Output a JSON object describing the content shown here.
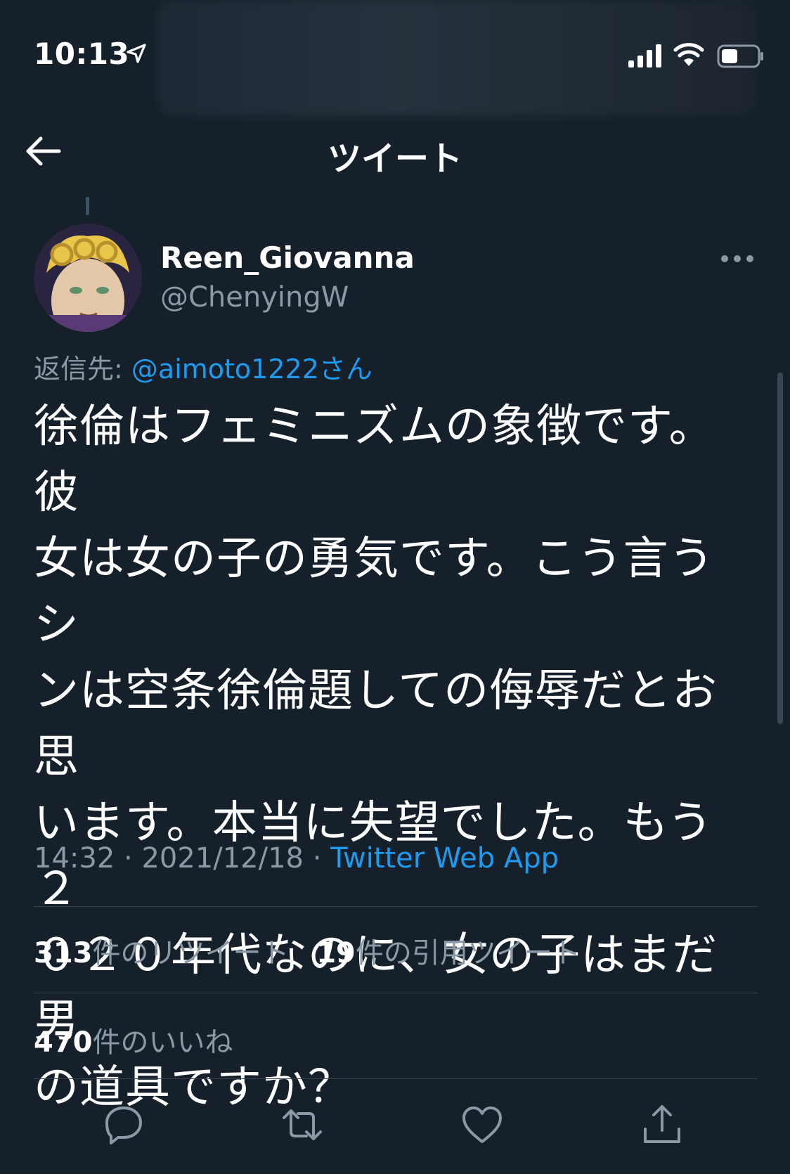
{
  "status_bar": {
    "time": "10:13",
    "icons": [
      "location-arrow-icon",
      "signal-bars-icon",
      "wifi-icon",
      "battery-icon"
    ]
  },
  "header": {
    "title": "ツイート",
    "back_icon": "back-arrow-icon"
  },
  "tweet": {
    "avatar_icon": "avatar-image",
    "display_name": "Reen_Giovanna",
    "handle": "@ChenyingW",
    "reply_prefix": "返信先:",
    "reply_mention": "@aimoto1222",
    "reply_suffix": "さん",
    "text": "徐倫はフェミニズムの象徴です。彼\n女は女の子の勇気です。こう言うシ\nンは空条徐倫題しての侮辱だとお思\nいます。本当に失望でした。もう２\n０２０年代なのに、女の子はまだ男\nの道具ですか？",
    "time": "14:32",
    "separator": "·",
    "date": "2021/12/18",
    "source": "Twitter Web App"
  },
  "stats": {
    "retweets_count": "313",
    "retweets_label": "件のリツイート",
    "quotes_count": "19",
    "quotes_label": "件の引用ツイート",
    "likes_count": "470",
    "likes_label": "件のいいね"
  },
  "actions": [
    "reply-icon",
    "retweet-icon",
    "like-icon",
    "share-icon"
  ],
  "colors": {
    "background": "#15202b",
    "accent": "#1d9bf0",
    "secondary_text": "#8b98a5",
    "divider": "#38444d"
  }
}
